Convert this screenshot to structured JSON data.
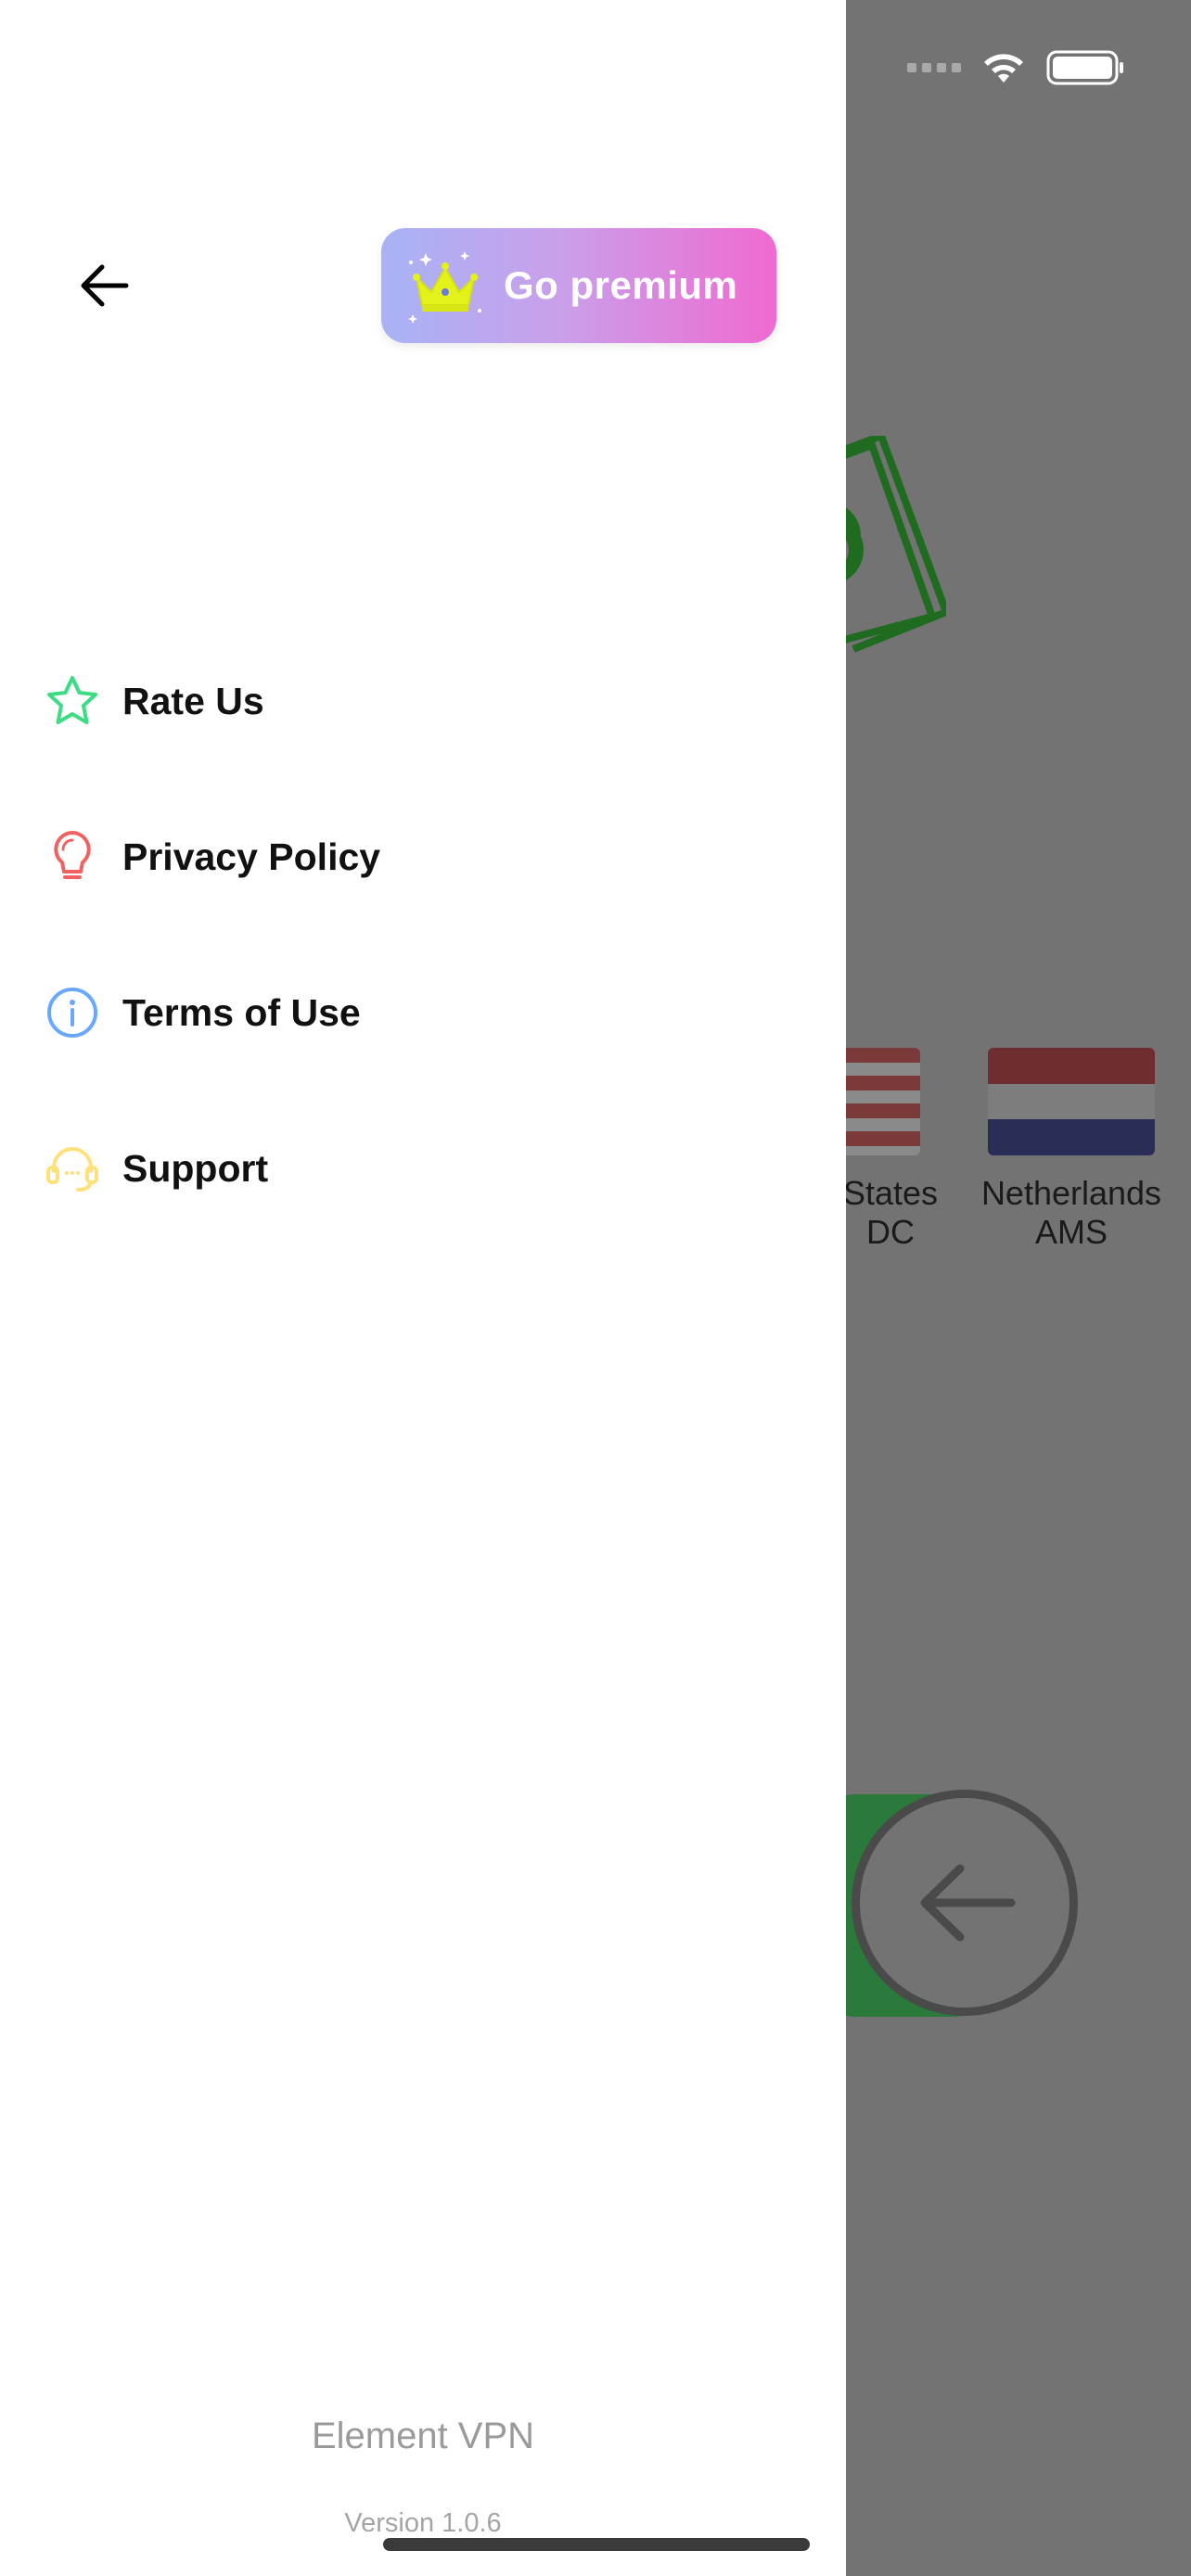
{
  "background_app": {
    "servers": [
      {
        "line1": "States",
        "line2": "DC"
      },
      {
        "line1": "Netherlands",
        "line2": "AMS"
      }
    ]
  },
  "drawer": {
    "premium_label": "Go premium",
    "menu": [
      {
        "label": "Rate Us",
        "icon": "star-icon",
        "color": "#3ddc84"
      },
      {
        "label": "Privacy Policy",
        "icon": "lightbulb-icon",
        "color": "#f06262"
      },
      {
        "label": "Terms of Use",
        "icon": "info-icon",
        "color": "#6aa8ff"
      },
      {
        "label": "Support",
        "icon": "headset-icon",
        "color": "#ffe07a"
      }
    ],
    "app_name": "Element VPN",
    "version": "Version 1.0.6"
  },
  "colors": {
    "premium_gradient_start": "#a8b3f5",
    "premium_gradient_end": "#f06ad0",
    "crown": "#e4f21c",
    "overlay": "#737373"
  }
}
